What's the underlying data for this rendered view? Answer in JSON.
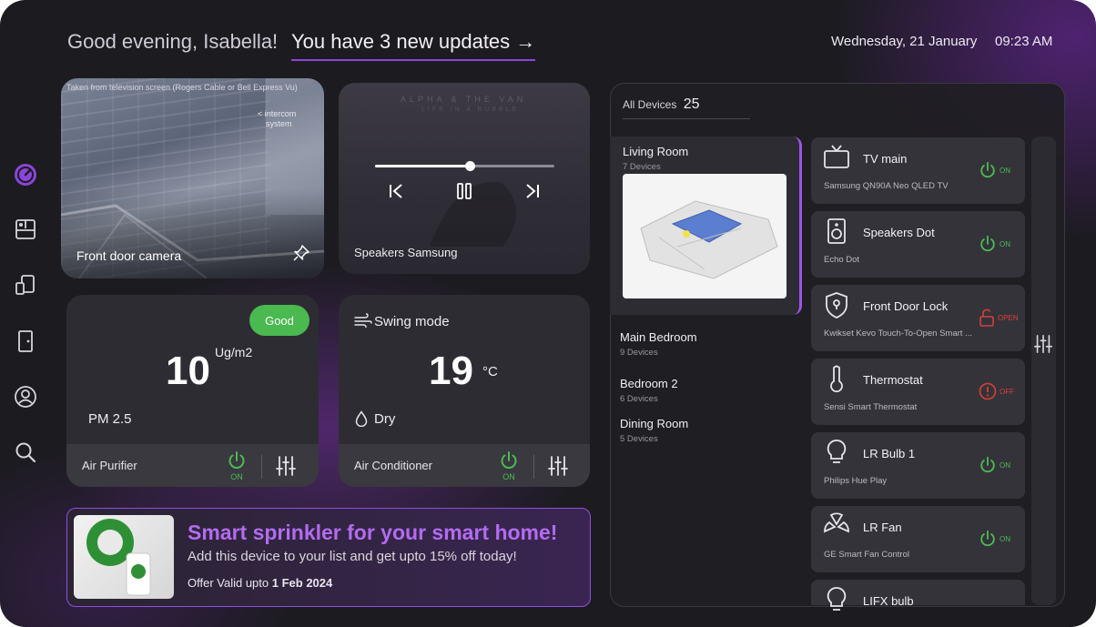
{
  "header": {
    "greeting": "Good evening, Isabella!",
    "updates_link": "You have 3 new updates →",
    "date": "Wednesday, 21 January",
    "time": "09:23 AM"
  },
  "sidebar": {
    "items": [
      {
        "icon": "dashboard-gauge-icon",
        "active": true
      },
      {
        "icon": "rooms-icon"
      },
      {
        "icon": "devices-icon"
      },
      {
        "icon": "door-icon"
      },
      {
        "icon": "profile-icon"
      },
      {
        "icon": "search-icon"
      }
    ]
  },
  "camera": {
    "label": "Front door camera",
    "feed_caption": "Taken from television screen (Rogers Cable or Bell Express Vu)",
    "intercom_note_1": "< intercom",
    "intercom_note_2": "system"
  },
  "speakers": {
    "album_title": "ALPHA & THE VAN",
    "album_subtitle": "LIFE IN A BUBBLE",
    "label": "Speakers Samsung",
    "progress": 0.53
  },
  "air_purifier": {
    "quality": "Good",
    "value": "10",
    "unit": "Ug/m2",
    "metric": "PM 2.5",
    "name": "Air Purifier",
    "power": "ON"
  },
  "air_conditioner": {
    "mode": "Swing mode",
    "temperature": "19",
    "unit": "°C",
    "setting": "Dry",
    "name": "Air Conditioner",
    "power": "ON"
  },
  "promo": {
    "title": "Smart sprinkler for your smart home!",
    "subtitle": "Add this device  to your list and get upto 15% off today!",
    "offer_prefix": "Offer Valid upto ",
    "offer_date": "1 Feb 2024"
  },
  "devices_panel": {
    "title": "All Devices",
    "count": "25",
    "rooms": [
      {
        "name": "Living Room",
        "devices": "7 Devices",
        "active": true
      },
      {
        "name": "Main Bedroom",
        "devices": "9 Devices"
      },
      {
        "name": "Bedroom 2",
        "devices": "6 Devices"
      },
      {
        "name": "Dining Room",
        "devices": "5 Devices"
      }
    ],
    "devices": [
      {
        "name": "TV main",
        "model": "Samsung QN90A Neo QLED TV",
        "status": "ON",
        "icon": "tv-icon"
      },
      {
        "name": "Speakers Dot",
        "model": "Echo Dot",
        "status": "ON",
        "icon": "speaker-icon"
      },
      {
        "name": "Front Door Lock",
        "model": "Kwikset Kevo Touch-To-Open Smart ...",
        "status": "OPEN",
        "icon": "shield-lock-icon"
      },
      {
        "name": "Thermostat",
        "model": "Sensi Smart Thermostat",
        "status": "OFF",
        "icon": "thermometer-icon"
      },
      {
        "name": "LR Bulb 1",
        "model": "Philips Hue Play",
        "status": "ON",
        "icon": "bulb-icon"
      },
      {
        "name": "LR Fan",
        "model": "GE Smart Fan Control",
        "status": "ON",
        "icon": "fan-icon"
      },
      {
        "name": "LIFX bulb",
        "model": "",
        "status": "",
        "icon": "bulb-icon"
      }
    ]
  },
  "colors": {
    "accent": "#8a45d8",
    "on": "#4cbb53",
    "off": "#d8403a",
    "background": "#1c1b20"
  }
}
